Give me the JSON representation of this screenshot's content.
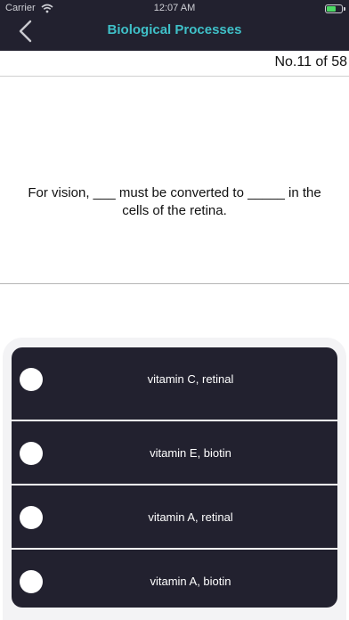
{
  "status_bar": {
    "carrier": "Carrier",
    "time": "12:07 AM",
    "icons": [
      "wifi-icon",
      "battery-icon"
    ]
  },
  "header": {
    "title": "Biological Processes",
    "back_icon": "chevron-left-icon"
  },
  "question_counter": "No.11 of 58",
  "question": {
    "text": "For vision, ___ must be converted to _____ in the cells of the retina."
  },
  "options": [
    {
      "label": "vitamin C, retinal"
    },
    {
      "label": "vitamin E, biotin"
    },
    {
      "label": "vitamin A, retinal"
    },
    {
      "label": "vitamin A, biotin"
    }
  ],
  "colors": {
    "header_background": "#22212f",
    "title_accent": "#3fc0c8",
    "option_background": "#22212f",
    "option_text": "#ffffff"
  }
}
